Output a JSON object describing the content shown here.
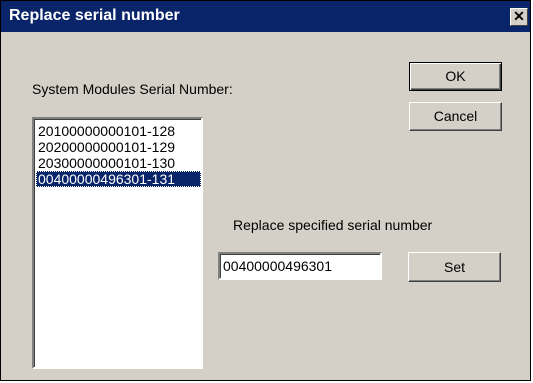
{
  "window": {
    "title": "Replace serial number",
    "close_glyph": "✕"
  },
  "left": {
    "label": "System Modules Serial Number:",
    "items": [
      "20100000000101-128",
      "20200000000101-129",
      "20300000000101-130",
      "00400000496301-131"
    ],
    "selected_index": 3
  },
  "buttons": {
    "ok": "OK",
    "cancel": "Cancel",
    "set": "Set"
  },
  "replace": {
    "label": "Replace specified serial number",
    "value": "00400000496301"
  }
}
